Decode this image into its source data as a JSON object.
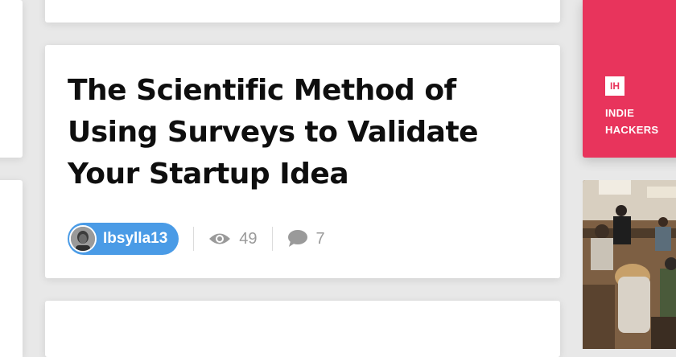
{
  "post": {
    "title": "The Scientific Method of Using Surveys to Validate Your Startup Idea",
    "author": "Ibsylla13",
    "views": "49",
    "comments": "7"
  },
  "promo": {
    "logo_text": "IH",
    "name": "INDIE HACKERS"
  },
  "icons": {
    "views": "eye-icon",
    "comments": "comment-bubble-icon"
  },
  "colors": {
    "author_pill": "#4a9be6",
    "promo_bg": "#e8345c",
    "stat_text": "#9a9a9a",
    "title_text": "#0e0e0e"
  }
}
